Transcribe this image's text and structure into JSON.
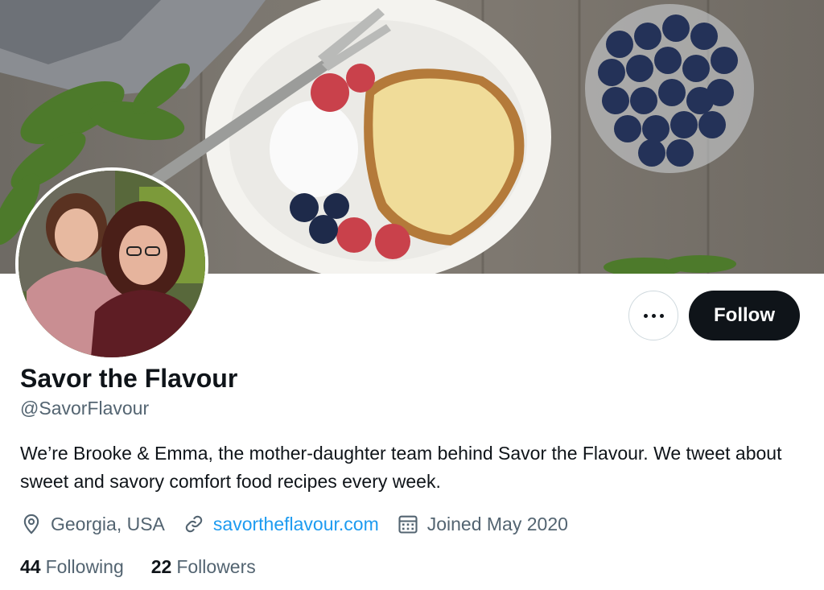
{
  "profile": {
    "display_name": "Savor the Flavour",
    "handle": "@SavorFlavour",
    "bio": "We’re Brooke & Emma, the mother-daughter team behind Savor the Flavour. We tweet about sweet and savory comfort food recipes every week.",
    "location": "Georgia, USA",
    "website": "savortheflavour.com",
    "joined": "Joined May 2020"
  },
  "actions": {
    "follow_label": "Follow",
    "more_icon": "more-horizontal-icon"
  },
  "stats": {
    "following_count": "44",
    "following_label": "Following",
    "followers_count": "22",
    "followers_label": "Followers"
  },
  "icons": {
    "location": "location-pin-icon",
    "website": "link-icon",
    "joined": "calendar-icon"
  },
  "colors": {
    "text_primary": "#0f1419",
    "text_secondary": "#536471",
    "link": "#1d9bf0",
    "follow_bg": "#0f1419",
    "border": "#cfd9de"
  }
}
